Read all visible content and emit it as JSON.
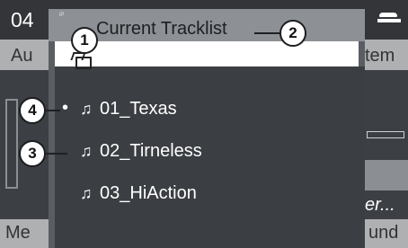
{
  "status_bar": {
    "time_partial": "04",
    "phone_icon": "phone-icon"
  },
  "background_menu": {
    "left_top": "Au",
    "right_top": "tem",
    "right_bottom": "er...",
    "bottom_left": "Me",
    "bottom_right": "und"
  },
  "overlay": {
    "title": "Current Tracklist",
    "source_mark": "iP",
    "folder_icon": "folder-up-icon",
    "tracks": [
      {
        "label": "01_Texas",
        "icon": "music-note-icon",
        "current": true
      },
      {
        "label": "02_Tirneless",
        "icon": "music-note-icon",
        "current": false
      },
      {
        "label": "03_HiAction",
        "icon": "music-note-icon",
        "current": false
      }
    ]
  },
  "callouts": [
    "1",
    "2",
    "3",
    "4"
  ],
  "colors": {
    "frame": "#5a5e63",
    "header": "#8d9195",
    "list_bg": "#3b3e42",
    "input_bg": "#ffffff"
  }
}
